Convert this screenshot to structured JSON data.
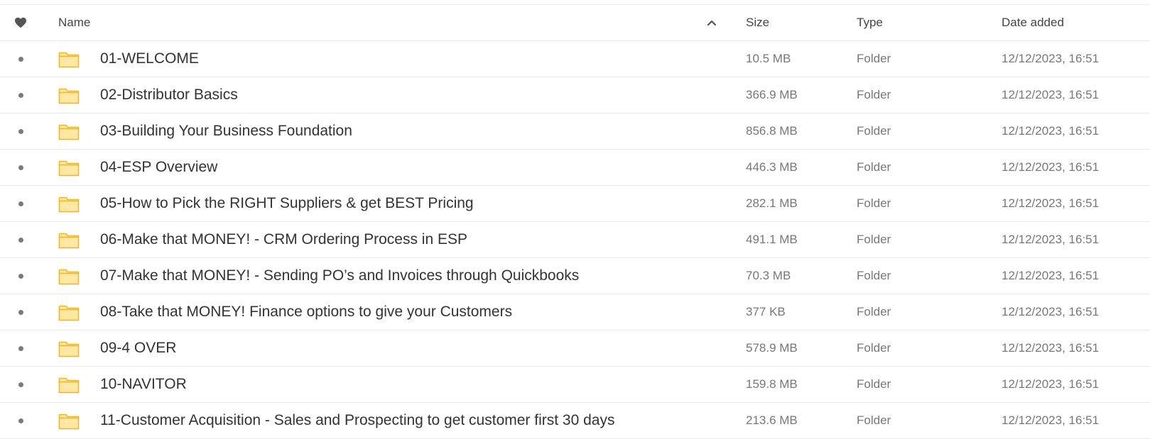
{
  "header": {
    "favorite_icon": "heart-icon",
    "name_label": "Name",
    "sort_icon": "chevron-up-icon",
    "size_label": "Size",
    "type_label": "Type",
    "date_label": "Date added"
  },
  "colors": {
    "folder_fill": "#ffe8a3",
    "folder_stroke": "#f2b51c",
    "text": "#333333",
    "muted": "#777777"
  },
  "rows": [
    {
      "name": "01-WELCOME",
      "size": "10.5 MB",
      "type": "Folder",
      "date": "12/12/2023, 16:51"
    },
    {
      "name": "02-Distributor Basics",
      "size": "366.9 MB",
      "type": "Folder",
      "date": "12/12/2023, 16:51"
    },
    {
      "name": "03-Building Your Business Foundation",
      "size": "856.8 MB",
      "type": "Folder",
      "date": "12/12/2023, 16:51"
    },
    {
      "name": "04-ESP Overview",
      "size": "446.3 MB",
      "type": "Folder",
      "date": "12/12/2023, 16:51"
    },
    {
      "name": "05-How to Pick the RIGHT Suppliers & get BEST Pricing",
      "size": "282.1 MB",
      "type": "Folder",
      "date": "12/12/2023, 16:51"
    },
    {
      "name": "06-Make that MONEY! - CRM Ordering Process in ESP",
      "size": "491.1 MB",
      "type": "Folder",
      "date": "12/12/2023, 16:51"
    },
    {
      "name": "07-Make that MONEY! - Sending PO’s and Invoices through Quickbooks",
      "size": "70.3 MB",
      "type": "Folder",
      "date": "12/12/2023, 16:51"
    },
    {
      "name": "08-Take that MONEY! Finance options to give your Customers",
      "size": "377 KB",
      "type": "Folder",
      "date": "12/12/2023, 16:51"
    },
    {
      "name": "09-4 OVER",
      "size": "578.9 MB",
      "type": "Folder",
      "date": "12/12/2023, 16:51"
    },
    {
      "name": "10-NAVITOR",
      "size": "159.8 MB",
      "type": "Folder",
      "date": "12/12/2023, 16:51"
    },
    {
      "name": "11-Customer Acquisition - Sales and Prospecting to get customer first 30 days",
      "size": "213.6 MB",
      "type": "Folder",
      "date": "12/12/2023, 16:51"
    }
  ]
}
